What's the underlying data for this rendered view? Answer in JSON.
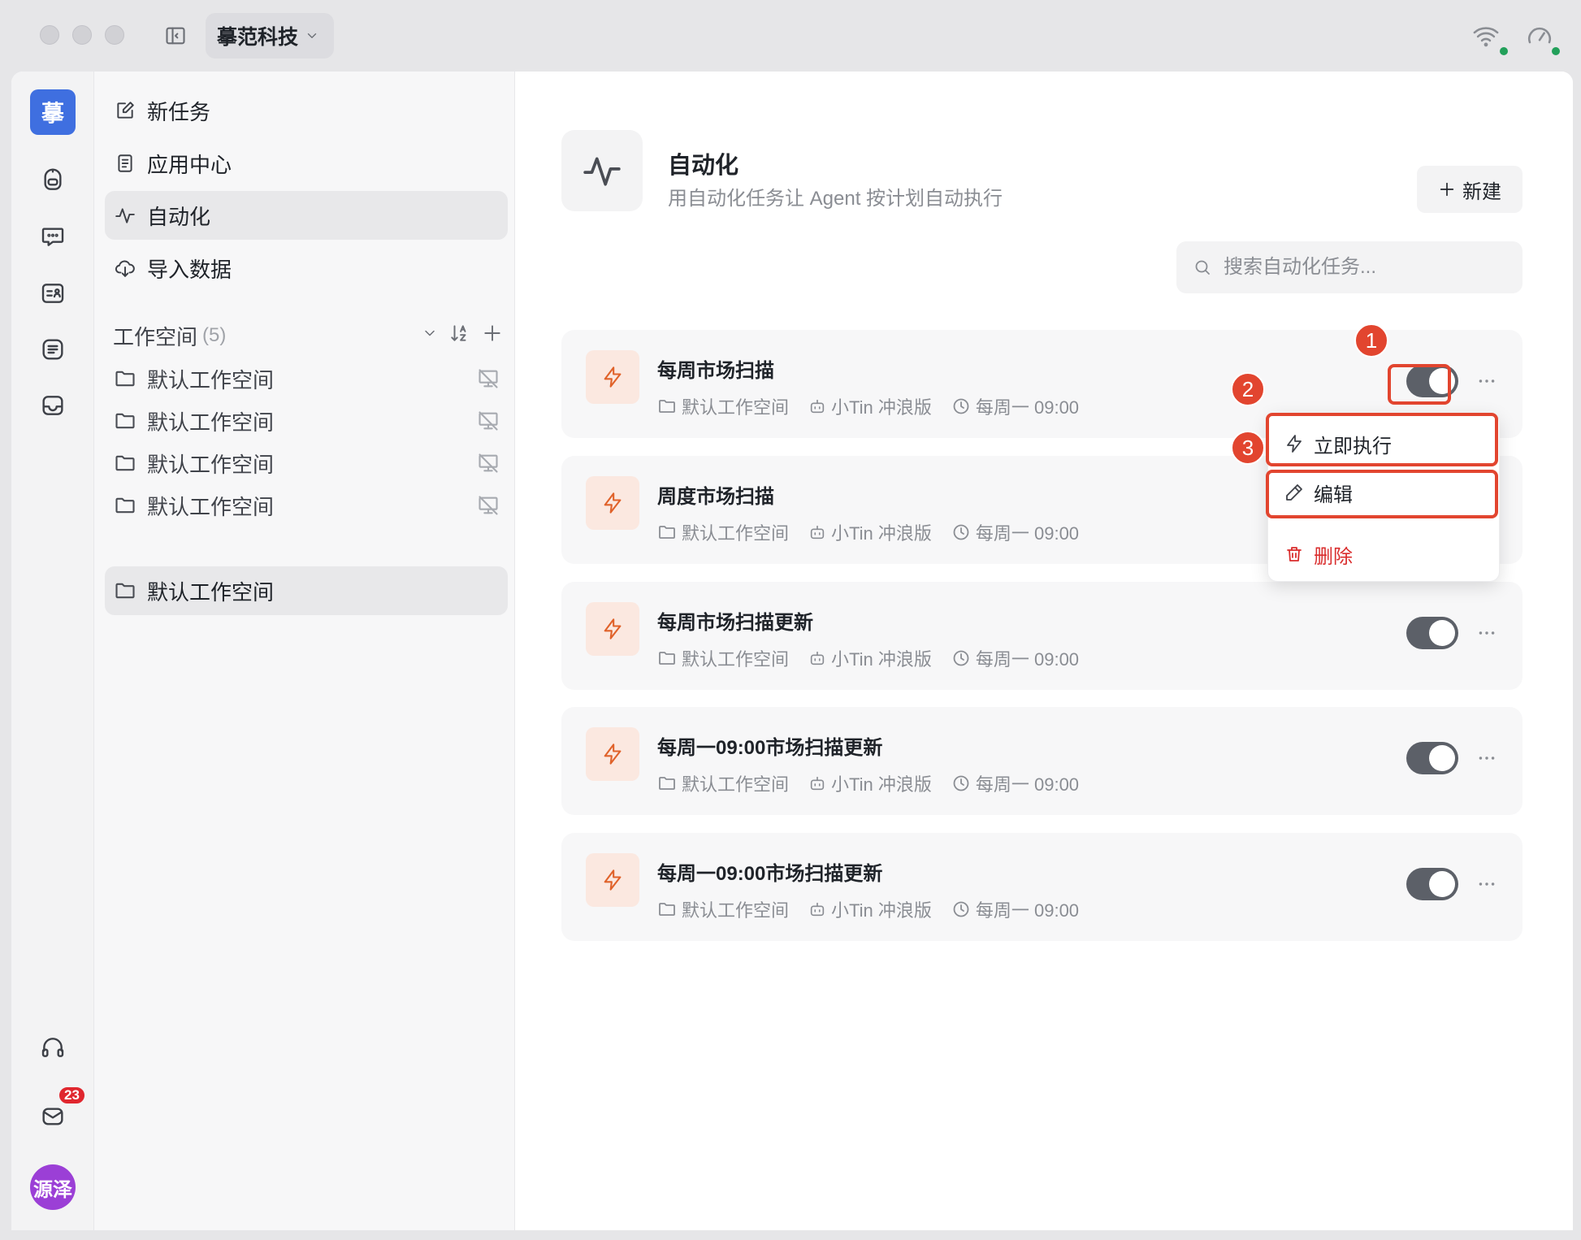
{
  "titlebar": {
    "org_name": "摹范科技",
    "org_icon": "chevron-down-icon",
    "status_icons": [
      "wifi-icon",
      "speedometer-icon"
    ],
    "status_dot_color": "#22a05a"
  },
  "rail": {
    "logo_text": "摹",
    "logo_color": "#3f6fe0",
    "icons": [
      "robot-icon",
      "chat-icon",
      "contacts-icon",
      "notes-icon",
      "inbox-icon",
      "headset-icon",
      "mail-icon"
    ],
    "mail_badge": "23",
    "avatar_text": "源泽",
    "avatar_color": "#9b3fd6"
  },
  "nav": {
    "items": [
      {
        "label": "新任务",
        "icon": "edit-icon"
      },
      {
        "label": "应用中心",
        "icon": "document-icon"
      },
      {
        "label": "自动化",
        "icon": "activity-icon",
        "active": true
      },
      {
        "label": "导入数据",
        "icon": "cloud-download-icon"
      }
    ]
  },
  "workspaces": {
    "title": "工作空间",
    "count": "(5)",
    "items": [
      {
        "label": "默认工作空间",
        "offline": true
      },
      {
        "label": "默认工作空间",
        "offline": true
      },
      {
        "label": "默认工作空间",
        "offline": true
      },
      {
        "label": "默认工作空间",
        "offline": true
      },
      {
        "label": "默认工作空间",
        "active": true
      }
    ]
  },
  "header": {
    "title": "自动化",
    "subtitle": "用自动化任务让 Agent 按计划自动执行",
    "new_button": "新建"
  },
  "search": {
    "placeholder": "搜索自动化任务..."
  },
  "tasks": [
    {
      "title": "每周市场扫描",
      "workspace": "默认工作空间",
      "agent": "小Tin 冲浪版",
      "schedule": "每周一 09:00",
      "enabled": true
    },
    {
      "title": "周度市场扫描",
      "workspace": "默认工作空间",
      "agent": "小Tin 冲浪版",
      "schedule": "每周一 09:00",
      "enabled": true
    },
    {
      "title": "每周市场扫描更新",
      "workspace": "默认工作空间",
      "agent": "小Tin 冲浪版",
      "schedule": "每周一 09:00",
      "enabled": true
    },
    {
      "title": "每周一09:00市场扫描更新",
      "workspace": "默认工作空间",
      "agent": "小Tin 冲浪版",
      "schedule": "每周一 09:00",
      "enabled": true
    },
    {
      "title": "每周一09:00市场扫描更新",
      "workspace": "默认工作空间",
      "agent": "小Tin 冲浪版",
      "schedule": "每周一 09:00",
      "enabled": true
    }
  ],
  "context_menu": {
    "items": [
      {
        "label": "立即执行",
        "icon": "bolt-icon"
      },
      {
        "label": "编辑",
        "icon": "pencil-icon"
      },
      {
        "label": "删除",
        "icon": "trash-icon",
        "danger": true
      }
    ]
  },
  "annotations": {
    "markers": [
      "1",
      "2",
      "3"
    ],
    "color": "#e2452f"
  },
  "colors": {
    "accent_orange": "#e0622a",
    "danger": "#d92d2d",
    "toggle_on": "#5c6068"
  }
}
